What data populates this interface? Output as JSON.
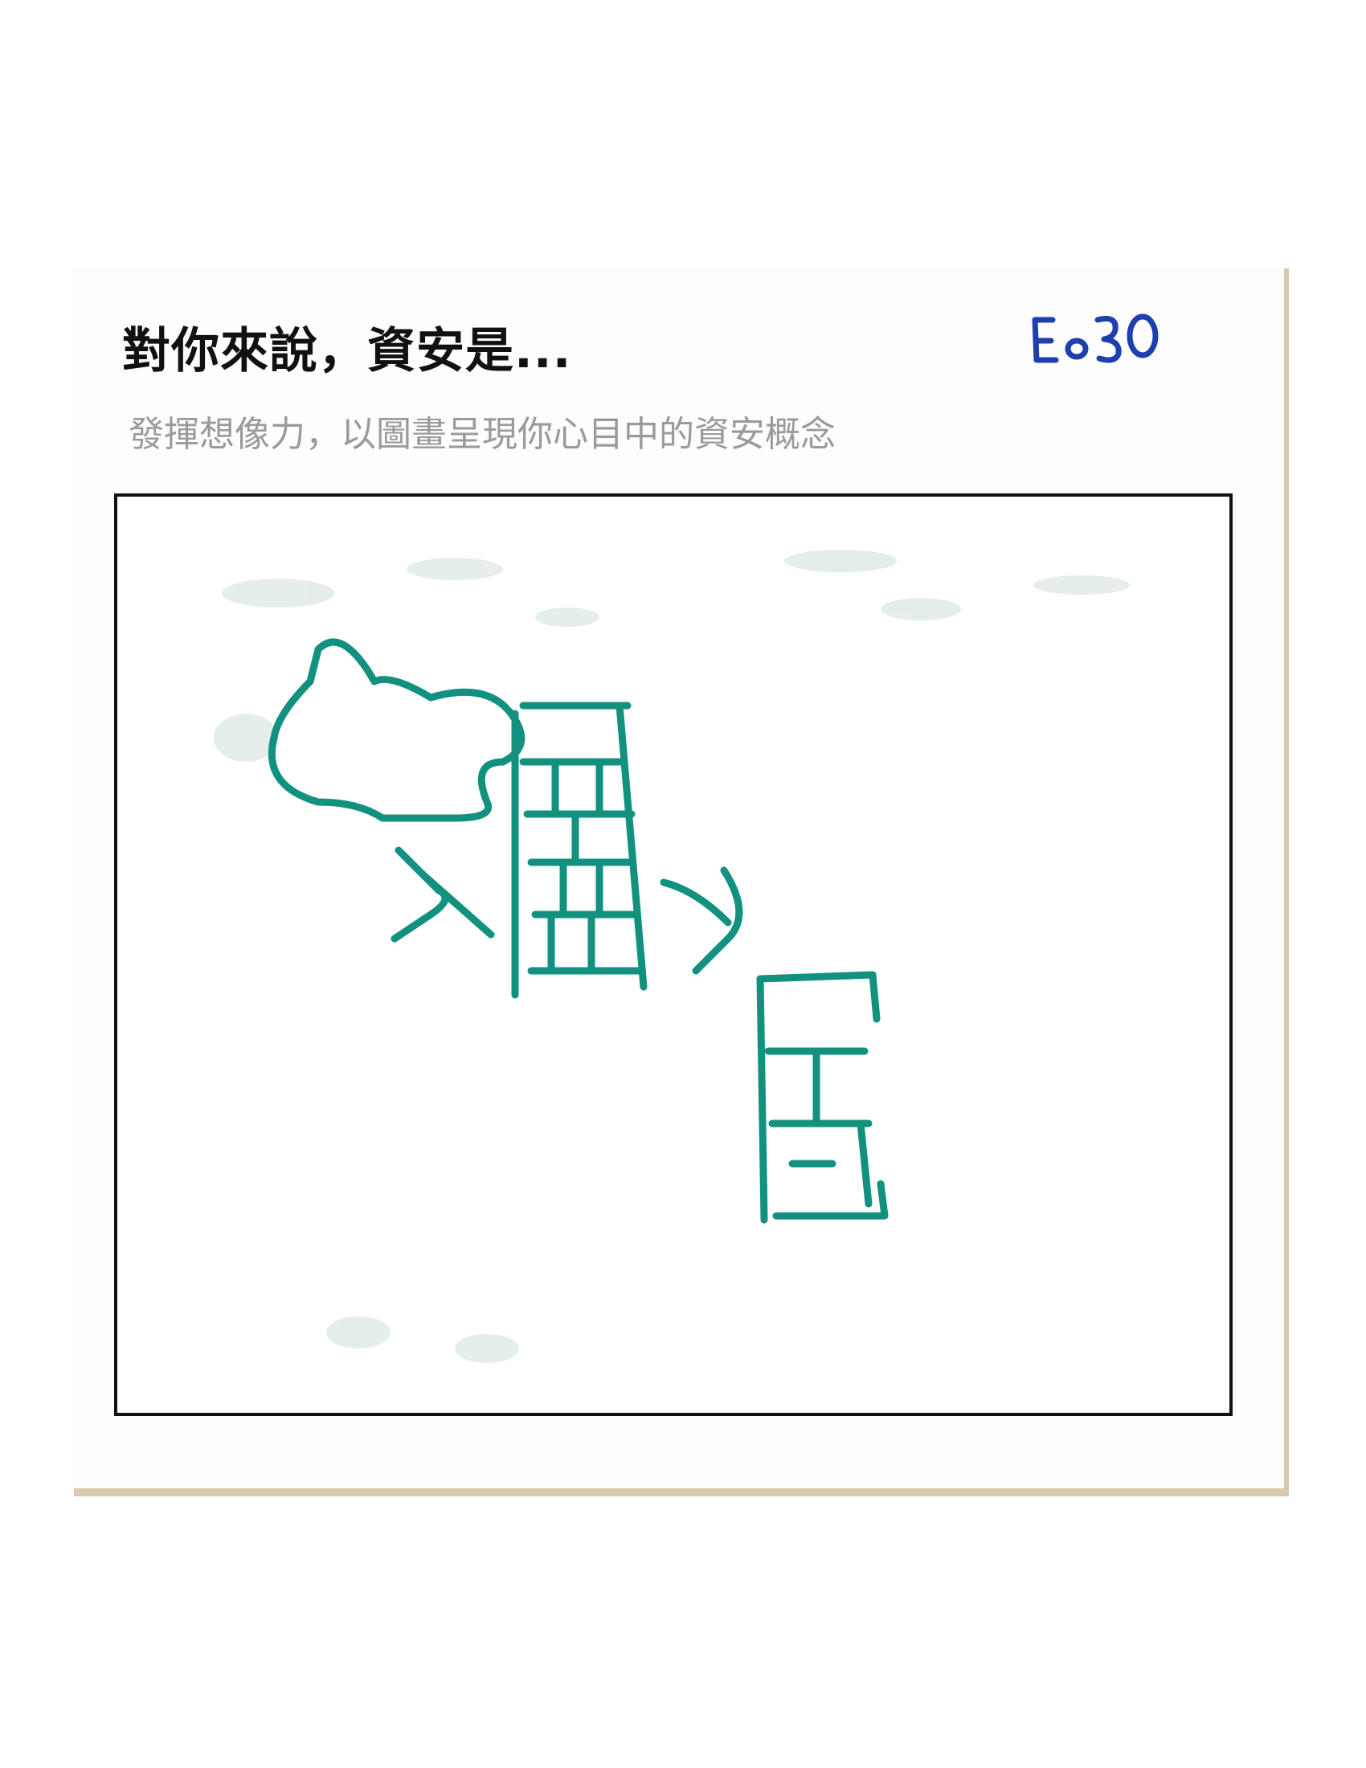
{
  "card": {
    "title": "對你來說，資安是...",
    "subtitle": "發揮想像力，以圖畫呈現你心目中的資安概念",
    "code": "E030"
  },
  "drawing": {
    "ink_color": "#12917f",
    "code_ink_color": "#1d3fb0",
    "elements": [
      "cloud",
      "arrow",
      "firewall",
      "arrow",
      "server"
    ]
  }
}
